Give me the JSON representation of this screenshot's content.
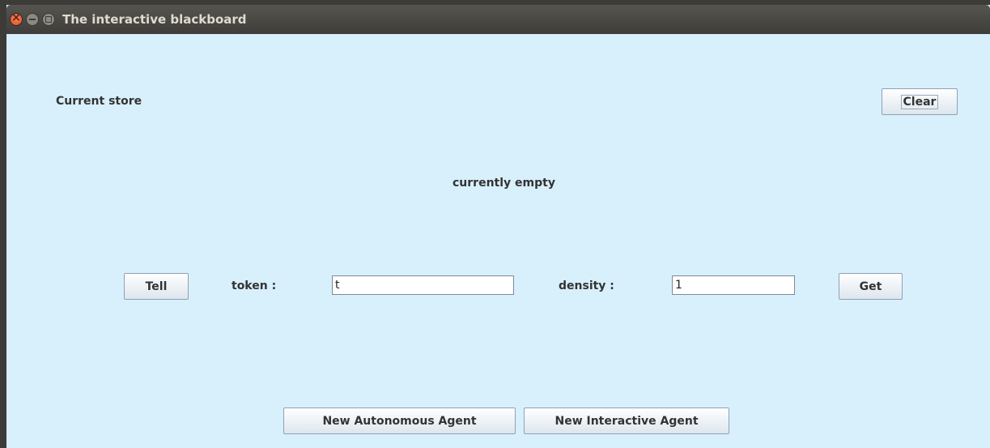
{
  "window": {
    "title": "The interactive blackboard"
  },
  "store": {
    "label": "Current store",
    "status": "currently empty",
    "clear_label": "Clear"
  },
  "controls": {
    "tell_label": "Tell",
    "token_label": "token :",
    "token_value": "t",
    "density_label": "density :",
    "density_value": "1",
    "get_label": "Get"
  },
  "agents": {
    "autonomous_label": "New Autonomous Agent",
    "interactive_label": "New Interactive Agent"
  },
  "colors": {
    "background": "#d8f0fc",
    "titlebar": "#3e3d39",
    "close_button": "#e4491d"
  }
}
